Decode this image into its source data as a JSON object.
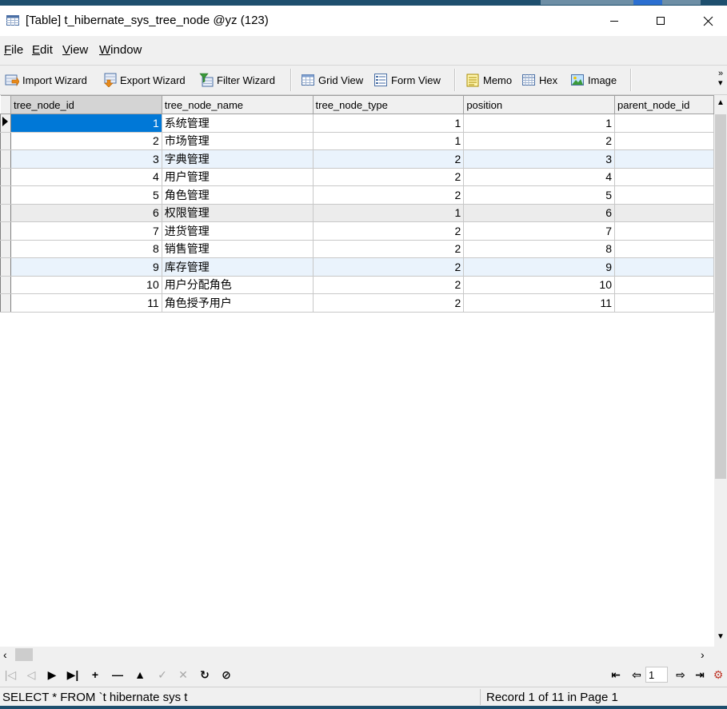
{
  "window": {
    "title": "[Table] t_hibernate_sys_tree_node @yz (123)",
    "controls": {
      "minimize": "—",
      "maximize": "☐",
      "close": "✕"
    }
  },
  "menu": [
    {
      "label": "File",
      "accel": "F",
      "rest": "ile"
    },
    {
      "label": "Edit",
      "accel": "E",
      "rest": "dit"
    },
    {
      "label": "View",
      "accel": "V",
      "rest": "iew"
    },
    {
      "label": "Window",
      "accel": "W",
      "rest": "indow"
    }
  ],
  "toolbar": {
    "import_wizard": {
      "label": "Import Wizard",
      "icon": "import-icon"
    },
    "export_wizard": {
      "label": "Export Wizard",
      "icon": "export-icon"
    },
    "filter_wizard": {
      "label": "Filter Wizard",
      "icon": "filter-icon"
    },
    "grid_view": {
      "label": "Grid View",
      "icon": "grid-icon"
    },
    "form_view": {
      "label": "Form View",
      "icon": "form-icon"
    },
    "memo": {
      "label": "Memo",
      "icon": "memo-icon"
    },
    "hex": {
      "label": "Hex",
      "icon": "hex-icon"
    },
    "image": {
      "label": "Image",
      "icon": "image-icon"
    },
    "more": "»"
  },
  "grid": {
    "columns": [
      "tree_node_id",
      "tree_node_name",
      "tree_node_type",
      "position",
      "parent_node_id"
    ],
    "rows": [
      {
        "id": "1",
        "name": "系统管理",
        "type": "1",
        "position": "1",
        "parent": ""
      },
      {
        "id": "2",
        "name": "市场管理",
        "type": "1",
        "position": "2",
        "parent": ""
      },
      {
        "id": "3",
        "name": "字典管理",
        "type": "2",
        "position": "3",
        "parent": ""
      },
      {
        "id": "4",
        "name": "用户管理",
        "type": "2",
        "position": "4",
        "parent": ""
      },
      {
        "id": "5",
        "name": "角色管理",
        "type": "2",
        "position": "5",
        "parent": ""
      },
      {
        "id": "6",
        "name": "权限管理",
        "type": "1",
        "position": "6",
        "parent": ""
      },
      {
        "id": "7",
        "name": "进货管理",
        "type": "2",
        "position": "7",
        "parent": ""
      },
      {
        "id": "8",
        "name": "销售管理",
        "type": "2",
        "position": "8",
        "parent": ""
      },
      {
        "id": "9",
        "name": "库存管理",
        "type": "2",
        "position": "9",
        "parent": ""
      },
      {
        "id": "10",
        "name": "用户分配角色",
        "type": "2",
        "position": "10",
        "parent": ""
      },
      {
        "id": "11",
        "name": "角色授予用户",
        "type": "2",
        "position": "11",
        "parent": ""
      }
    ]
  },
  "navigator": {
    "page": "1"
  },
  "status": {
    "sql": "SELECT * FROM `t hibernate sys t",
    "record": "Record 1 of 11 in Page 1"
  },
  "colors": {
    "selection": "#0078d7",
    "alt_row_blue": "#eaf3fc",
    "alt_row_gray": "#ececec"
  }
}
